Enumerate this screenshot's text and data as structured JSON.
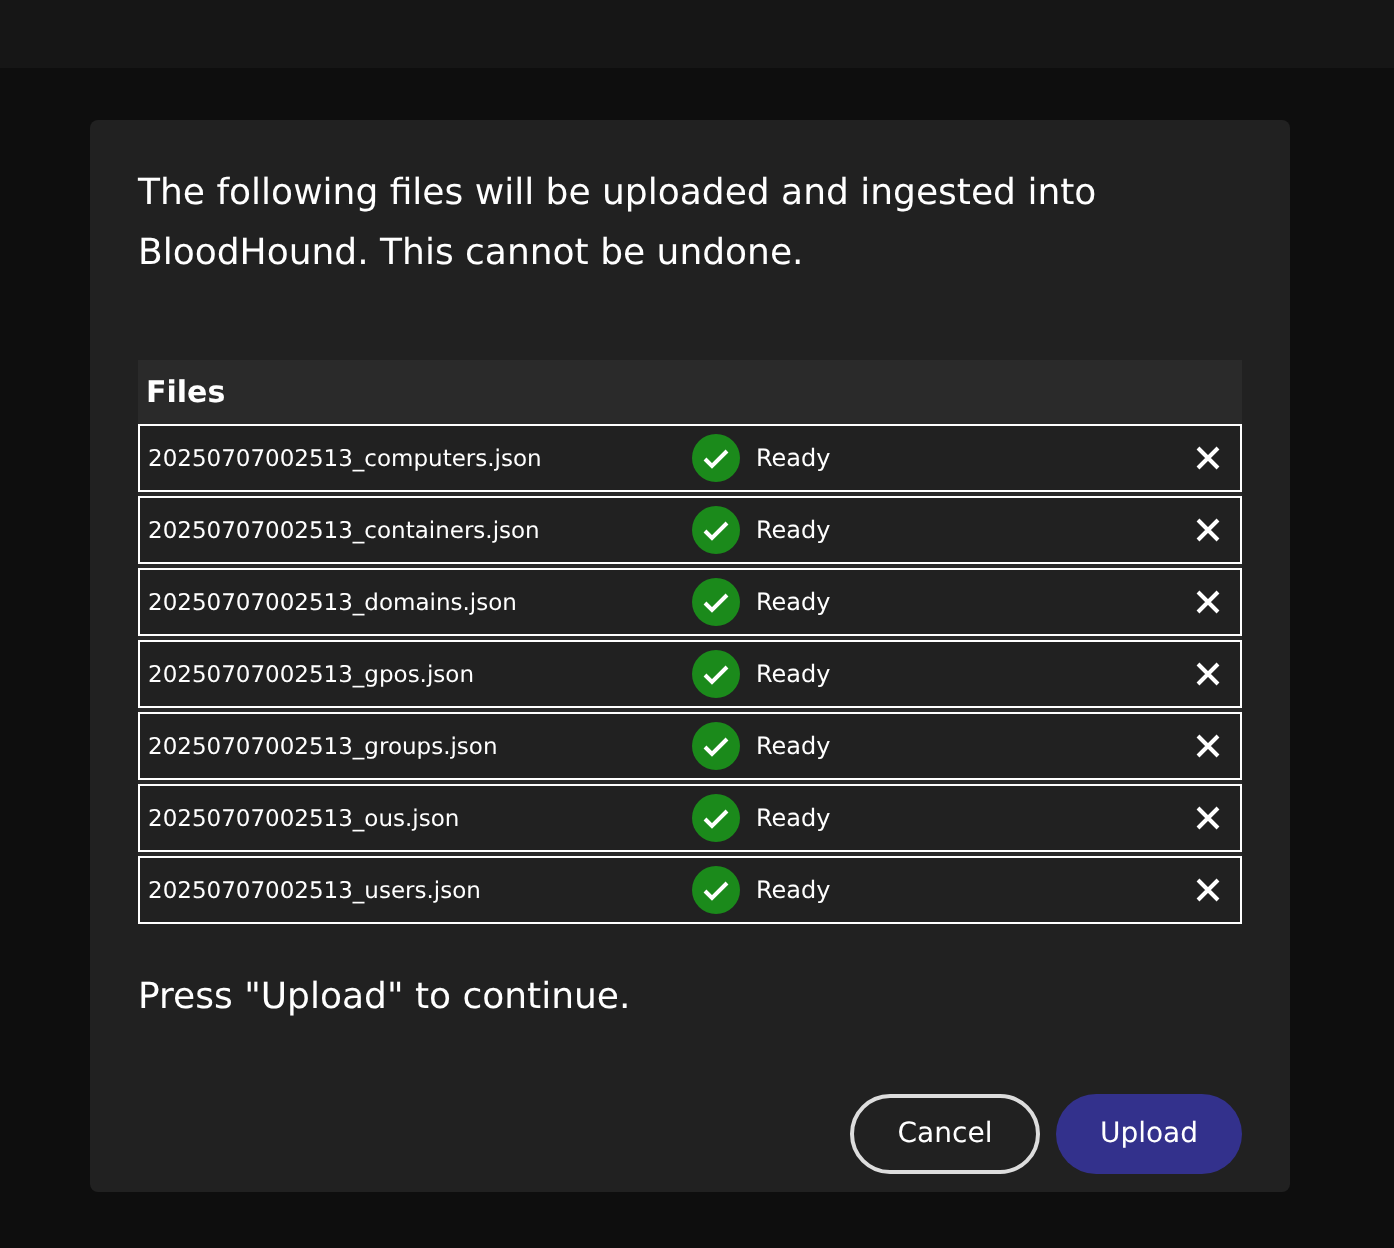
{
  "dialog": {
    "message": "The following files will be uploaded and ingested into BloodHound. This cannot be undone.",
    "files_table": {
      "title": "Files",
      "rows": [
        {
          "name": "20250707002513_computers.json",
          "status": "Ready",
          "kind": "ready"
        },
        {
          "name": "20250707002513_containers.json",
          "status": "Ready",
          "kind": "ready"
        },
        {
          "name": "20250707002513_domains.json",
          "status": "Ready",
          "kind": "ready"
        },
        {
          "name": "20250707002513_gpos.json",
          "status": "Ready",
          "kind": "ready"
        },
        {
          "name": "20250707002513_groups.json",
          "status": "Ready",
          "kind": "ready"
        },
        {
          "name": "20250707002513_ous.json",
          "status": "Ready",
          "kind": "ready"
        },
        {
          "name": "20250707002513_users.json",
          "status": "Ready",
          "kind": "ready"
        }
      ]
    },
    "prompt": "Press \"Upload\" to continue.",
    "buttons": [
      {
        "label": "Cancel",
        "kind": "secondary"
      },
      {
        "label": "Upload",
        "kind": "primary"
      }
    ]
  }
}
